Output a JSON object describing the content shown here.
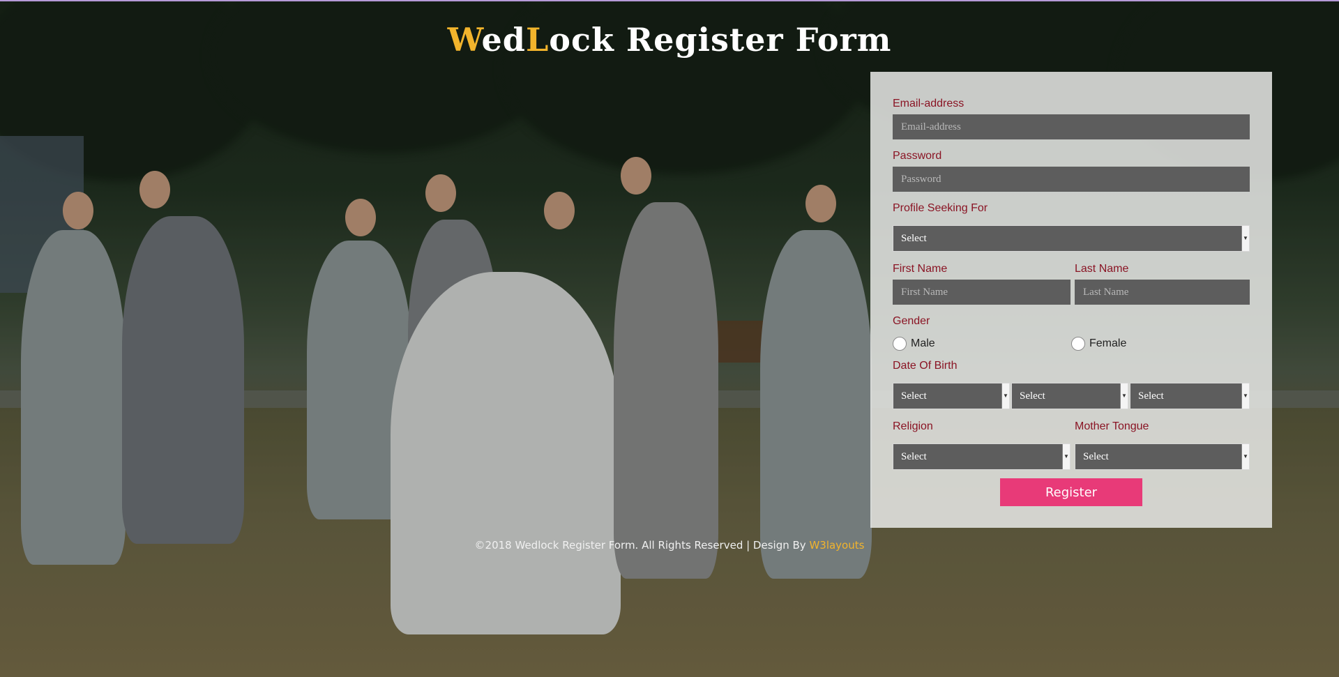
{
  "title": {
    "part1_accent": "W",
    "part2": "ed",
    "part3_accent": "L",
    "part4": "ock Register Form"
  },
  "form": {
    "email": {
      "label": "Email-address",
      "placeholder": "Email-address"
    },
    "password": {
      "label": "Password",
      "placeholder": "Password"
    },
    "profile_seeking": {
      "label": "Profile Seeking For",
      "selected": "Select"
    },
    "first_name": {
      "label": "First Name",
      "placeholder": "First Name"
    },
    "last_name": {
      "label": "Last Name",
      "placeholder": "Last Name"
    },
    "gender": {
      "label": "Gender",
      "options": [
        "Male",
        "Female"
      ]
    },
    "dob": {
      "label": "Date Of Birth",
      "day": "Select",
      "month": "Select",
      "year": "Select"
    },
    "religion": {
      "label": "Religion",
      "selected": "Select"
    },
    "mother_tongue": {
      "label": "Mother Tongue",
      "selected": "Select"
    },
    "register_label": "Register"
  },
  "footer": {
    "text": "©2018 Wedlock Register Form. All Rights Reserved | Design By ",
    "link_text": "W3layouts"
  },
  "colors": {
    "accent": "#f2b42c",
    "label": "#8a1424",
    "button": "#e83a78",
    "input_bg": "#5d5d5d"
  },
  "icons": {
    "select_arrow": "chevron-down-icon"
  }
}
